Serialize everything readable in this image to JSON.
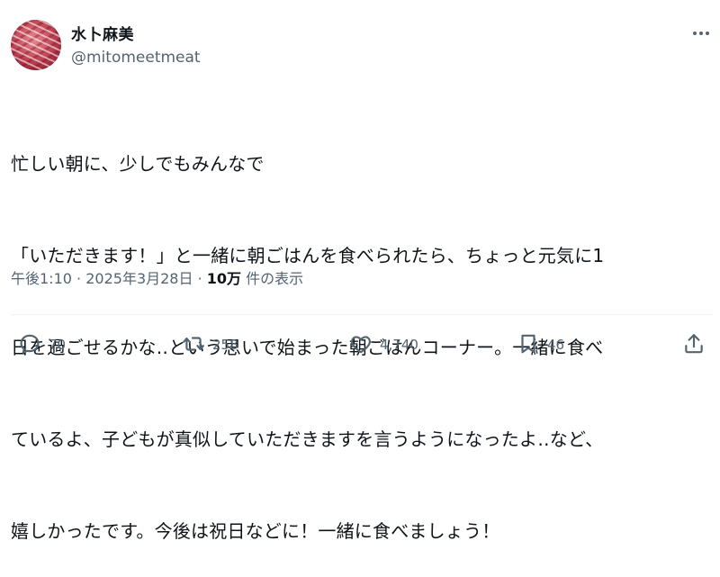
{
  "author": {
    "display_name": "水卜麻美",
    "handle": "@mitomeetmeat"
  },
  "tweet": {
    "lines": [
      "忙しい朝に、少しでもみんなで",
      "「いただきます！」と一緒に朝ごはんを食べられたら、ちょっと元気に1",
      "日を過ごせるかな‥という思いで始まった朝ごはんコーナー。一緒に食べ",
      "ているよ、子どもが真似していただきますを言うようになったよ‥など、",
      "嬉しかったです。今後は祝日などに！一緒に食べましょう！"
    ]
  },
  "meta": {
    "time": "午後1:10",
    "separator": "·",
    "date": "2025年3月28日",
    "views_count": "10万",
    "views_label": "件の表示"
  },
  "actions": {
    "replies": "70",
    "reposts": "258",
    "likes": "4,740",
    "bookmarks": "46"
  },
  "icons": [
    "more-icon",
    "reply-icon",
    "repost-icon",
    "like-icon",
    "bookmark-icon",
    "share-icon"
  ],
  "colors": {
    "text": "#0f1419",
    "secondary": "#536471",
    "divider": "#eff3f4"
  }
}
